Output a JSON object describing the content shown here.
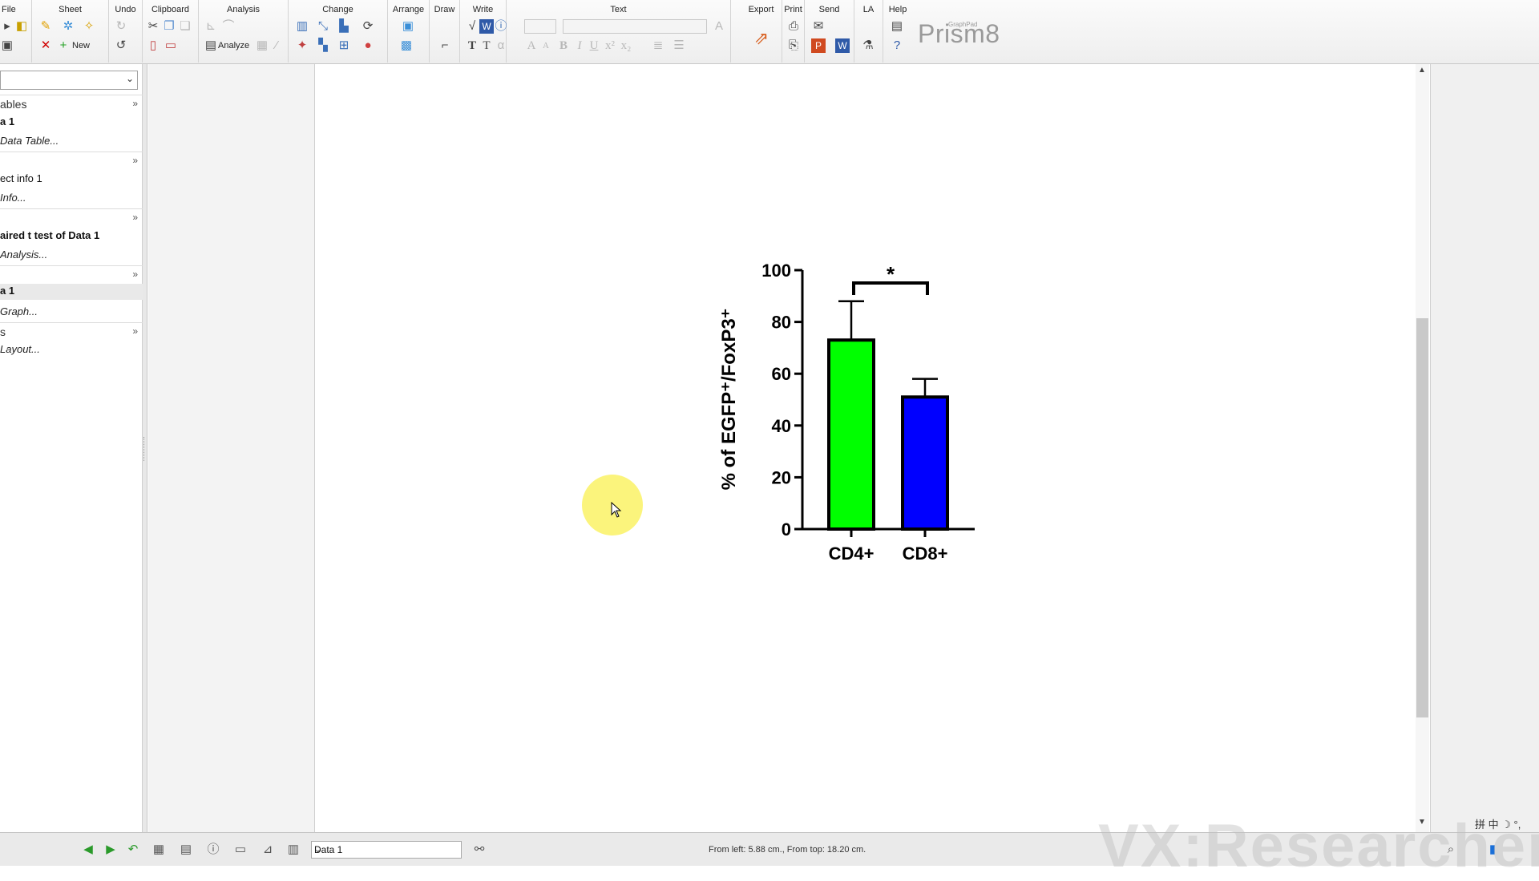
{
  "ribbon": {
    "groups": {
      "file": "File",
      "sheet": "Sheet",
      "undo": "Undo",
      "clipboard": "Clipboard",
      "analysis": "Analysis",
      "change": "Change",
      "arrange": "Arrange",
      "draw": "Draw",
      "write": "Write",
      "text": "Text",
      "export": "Export",
      "print": "Print",
      "send": "Send",
      "la": "LA",
      "help": "Help"
    },
    "new_label": "New",
    "analyze_label": "Analyze",
    "brand_small": "GraphPad",
    "brand": "Prism8"
  },
  "navigator": {
    "sections": [
      {
        "label": "ables",
        "items": [
          {
            "label": "a 1",
            "kind": "bold"
          },
          {
            "label": "Data Table...",
            "kind": "new"
          }
        ]
      },
      {
        "label": "",
        "items": [
          {
            "label": "ect info 1",
            "kind": "plain"
          },
          {
            "label": "Info...",
            "kind": "new"
          }
        ]
      },
      {
        "label": "",
        "items": [
          {
            "label": "aired t test of Data 1",
            "kind": "bold"
          },
          {
            "label": "Analysis...",
            "kind": "new"
          }
        ]
      },
      {
        "label": "",
        "items": [
          {
            "label": "a 1",
            "kind": "bold"
          },
          {
            "label": "Graph...",
            "kind": "new"
          }
        ]
      },
      {
        "label": "s",
        "items": [
          {
            "label": "Layout...",
            "kind": "new"
          }
        ]
      }
    ]
  },
  "chart_data": {
    "type": "bar",
    "categories": [
      "CD4+",
      "CD8+"
    ],
    "values": [
      73,
      51
    ],
    "errors": [
      15,
      7
    ],
    "colors": [
      "#00ff00",
      "#0000ff"
    ],
    "ylabel": "% of EGFP⁺/FoxP3⁺",
    "ylim": [
      0,
      100
    ],
    "yticks": [
      "0",
      "20",
      "40",
      "60",
      "80",
      "100"
    ],
    "significance": "*"
  },
  "statusbar": {
    "sheet_selected": "Data 1",
    "position_text": "From left: 5.88 cm., From top: 18.20 cm."
  },
  "watermark": "VX:ResearcherZi",
  "ime_text": "拼 中 ☽ °,",
  "colors": {
    "halo": "#f8ee4c",
    "sheet_bg": "#ffffff",
    "gutter_bg": "#f3f3f3"
  }
}
